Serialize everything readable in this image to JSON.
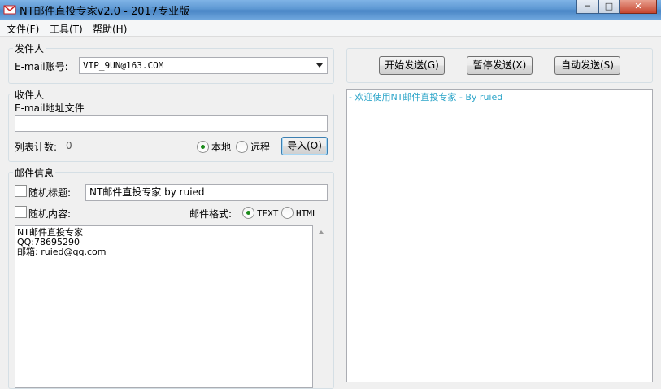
{
  "window": {
    "title": "NT邮件直投专家v2.0 - 2017专业版",
    "buttons": {
      "minimize": "─",
      "maximize": "□",
      "close": "✕"
    }
  },
  "menu": [
    {
      "label": "文件(F)"
    },
    {
      "label": "工具(T)"
    },
    {
      "label": "帮助(H)"
    }
  ],
  "sender": {
    "group_title": "发件人",
    "account_label": "E-mail账号:",
    "account_value": "VIP_9UN@163.COM"
  },
  "receiver": {
    "group_title": "收件人",
    "file_label": "E-mail地址文件",
    "file_value": "",
    "count_label": "列表计数:",
    "count_value": "0",
    "radio_local": "本地",
    "radio_remote": "远程",
    "import_button": "导入(O)"
  },
  "mail": {
    "group_title": "邮件信息",
    "random_subject_label": "随机标题:",
    "subject_value": "NT邮件直投专家 by ruied",
    "random_content_label": "随机内容:",
    "format_label": "邮件格式:",
    "format_text": "TEXT",
    "format_html": "HTML",
    "body_lines": [
      "NT邮件直投专家",
      "QQ:78695290",
      "邮箱: ruied@qq.com"
    ]
  },
  "actions": {
    "start": "开始发送(G)",
    "pause": "暂停发送(X)",
    "auto": "自动发送(S)"
  },
  "log": {
    "welcome": "- 欢迎使用NT邮件直投专家 - By ruied"
  },
  "colors": {
    "log_text": "#2aa4c8",
    "radio_selected": "#1a8a1a"
  }
}
